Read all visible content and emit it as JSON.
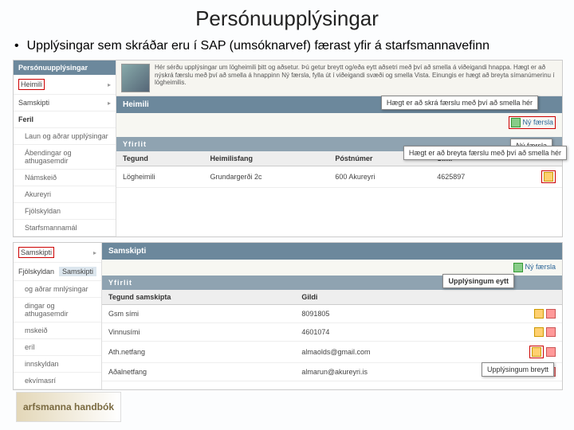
{
  "title": "Persónuupplýsingar",
  "bullet": "Upplýsingar sem skráðar eru í SAP (umsóknarvef) færast yfir á starfsmannavefinn",
  "block1": {
    "sidebar_header": "Persónuupplýsingar",
    "items": [
      "Heimili",
      "Samskipti",
      "Feril",
      "Laun og aðrar upplýsingar",
      "Ábendingar og athugasemdir",
      "Námskeið",
      "Akureyri",
      "Fjölskyldan",
      "Starfsmannamál"
    ],
    "intro": "Hér sérðu upplýsingar um lögheimili þitt og aðsetur. Þú getur breytt og/eða eytt aðsetri með því að smella á viðeigandi hnappa. Hægt er að nýskrá færslu með því að smella á hnappinn Ný færsla, fylla út í viðeigandi svæði og smella Vista. Einungis er hægt að breyta símanúmerinu í lögheimilis.",
    "section": "Heimili",
    "new_label": "Ný færsla",
    "tooltip_new": "Hægt er að skrá færslu með því að smella hér",
    "tooltip_new2": "Ný færsla",
    "overview": "Yfirlit",
    "cols": {
      "c1": "Tegund",
      "c2": "Heimilisfang",
      "c3": "Póstnúmer",
      "c4": "Sími"
    },
    "row": {
      "c1": "Lögheimili",
      "c2": "Grundargerði 2c",
      "c3": "600 Akureyri",
      "c4": "4625897"
    },
    "tooltip_edit": "Hægt er að breyta færslu með því að smella hér"
  },
  "block2": {
    "tab_a": "Samskipti",
    "tab_b": "Fjölskyldan",
    "tab_c": "Samskipti",
    "side": [
      "og aðrar mnlýsingar",
      "dingar og athugasemdir",
      "mskeið",
      "eríl",
      "innskyldan",
      "ekvímasrí"
    ],
    "section": "Samskipti",
    "new_label": "Ný færsla",
    "overview": "Yfirlit",
    "cols": {
      "c1": "Tegund samskipta",
      "c2": "Gildi"
    },
    "rows": [
      {
        "c1": "Gsm sími",
        "c2": "8091805"
      },
      {
        "c1": "Vinnusími",
        "c2": "4601074"
      },
      {
        "c1": "Ath.netfang",
        "c2": "almaolds@gmail.com"
      },
      {
        "c1": "Aðalnetfang",
        "c2": "almarun@akureyri.is"
      }
    ],
    "tooltip_del": "Upplýsingum eytt",
    "tooltip_edit": "Upplýsingum breytt"
  },
  "logo": "arfsmanna handbók"
}
